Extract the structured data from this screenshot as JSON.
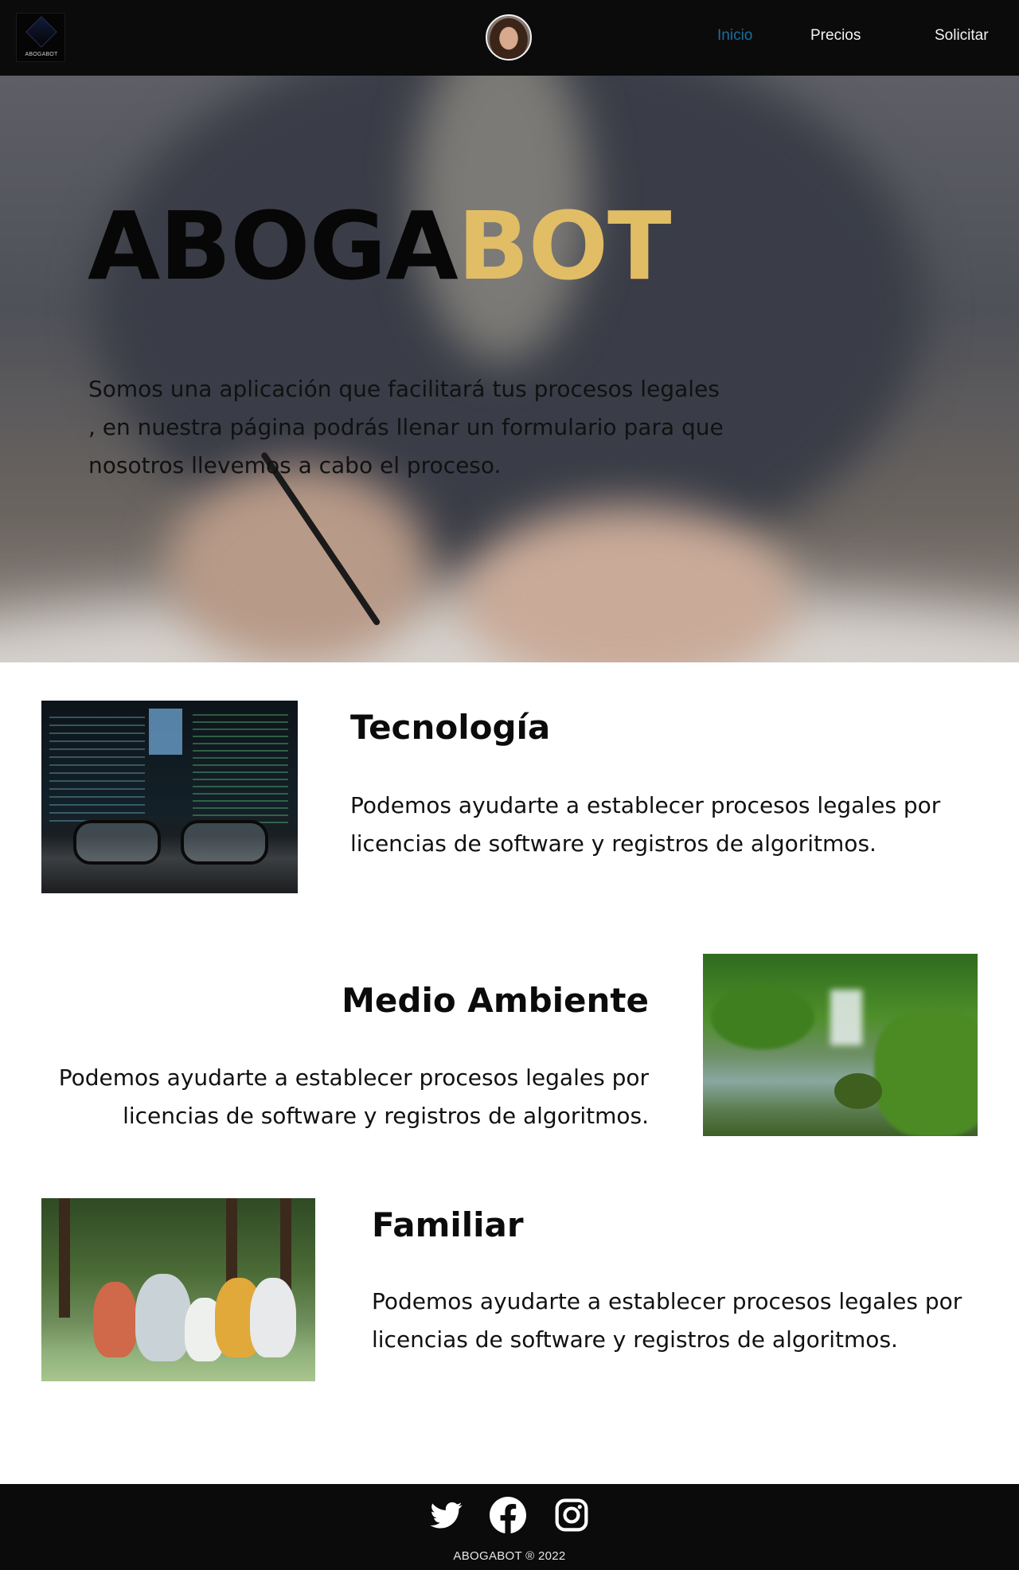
{
  "navbar": {
    "logo_text": "ABOGABOT",
    "links": [
      {
        "label": "Inicio",
        "active": true
      },
      {
        "label": "Precios",
        "active": false
      },
      {
        "label": "Solicitar",
        "active": false
      }
    ]
  },
  "hero": {
    "title_part1": "ABOGA",
    "title_part2": "BOT",
    "description": "Somos una aplicación que facilitará tus procesos legales , en nuestra página podrás llenar un formulario para que nosotros llevemos a cabo el proceso."
  },
  "features": [
    {
      "title": "Tecnología",
      "text": "Podemos ayudarte a establecer procesos legales por licencias de software y registros de algoritmos."
    },
    {
      "title": "Medio Ambiente",
      "text": "Podemos ayudarte a establecer procesos legales por licencias de software y registros de algoritmos."
    },
    {
      "title": "Familiar",
      "text": "Podemos ayudarte a establecer procesos legales por licencias de software y registros de algoritmos."
    }
  ],
  "footer": {
    "social_icons": [
      "twitter-icon",
      "facebook-icon",
      "instagram-icon"
    ],
    "copyright": "ABOGABOT ® 2022"
  },
  "colors": {
    "nav_background": "#0b0b0b",
    "active_link": "#1a6fa0",
    "brand_gold": "#e1bd66",
    "footer_background": "#0b0b0b"
  }
}
